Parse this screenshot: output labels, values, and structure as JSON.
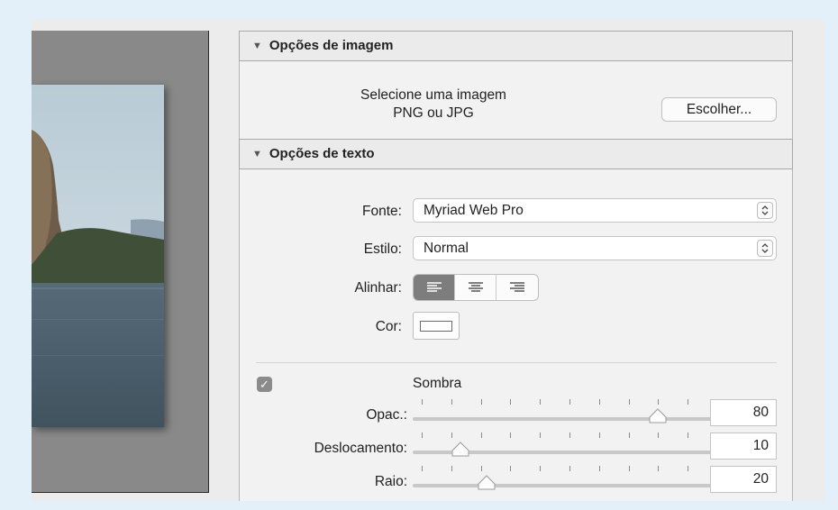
{
  "image_options": {
    "title": "Opções de imagem",
    "hint_line1": "Selecione uma imagem",
    "hint_line2": "PNG ou JPG",
    "choose_button": "Escolher..."
  },
  "text_options": {
    "title": "Opções de texto",
    "font_label": "Fonte:",
    "font_value": "Myriad Web Pro",
    "style_label": "Estilo:",
    "style_value": "Normal",
    "align_label": "Alinhar:",
    "align_options": [
      "left-align-icon",
      "center-align-icon",
      "right-align-icon"
    ],
    "align_selected": "left",
    "color_label": "Cor:",
    "color_value": "#ffffff"
  },
  "shadow": {
    "enabled": true,
    "label": "Sombra",
    "opacity": {
      "label": "Opac.:",
      "value": "80",
      "fraction": 0.8
    },
    "offset": {
      "label": "Deslocamento:",
      "value": "10",
      "fraction": 0.13
    },
    "radius": {
      "label": "Raio:",
      "value": "20",
      "fraction": 0.22
    }
  },
  "colors": {
    "page_background": "#e3f0f9",
    "panel_background": "#f2f2f2",
    "preview_background": "#898989",
    "selected_segment": "#7d7d7d"
  }
}
